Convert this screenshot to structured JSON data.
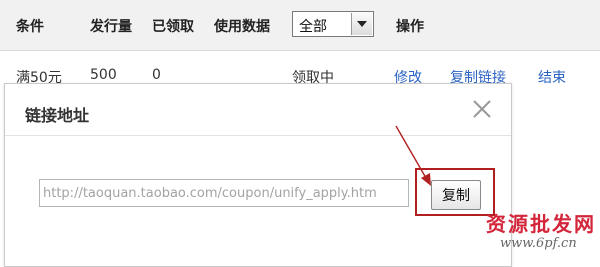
{
  "table": {
    "headers": [
      "条件",
      "发行量",
      "已领取",
      "使用数据",
      "操作"
    ],
    "filter_selected": "全部",
    "rows": [
      {
        "condition": "满50元",
        "issued": "500",
        "received": "0",
        "status": "领取中",
        "actions": [
          "修改",
          "复制链接",
          "结束"
        ]
      }
    ]
  },
  "dialog": {
    "title": "链接地址",
    "url_value": "http://taoquan.taobao.com/coupon/unify_apply.htm",
    "copy_label": "复制"
  },
  "watermark": {
    "text": "资源批发网",
    "url": "www.6pf.cn"
  },
  "colors": {
    "link": "#2b63c4",
    "annotation": "#b02020",
    "watermark": "#d4263b"
  }
}
